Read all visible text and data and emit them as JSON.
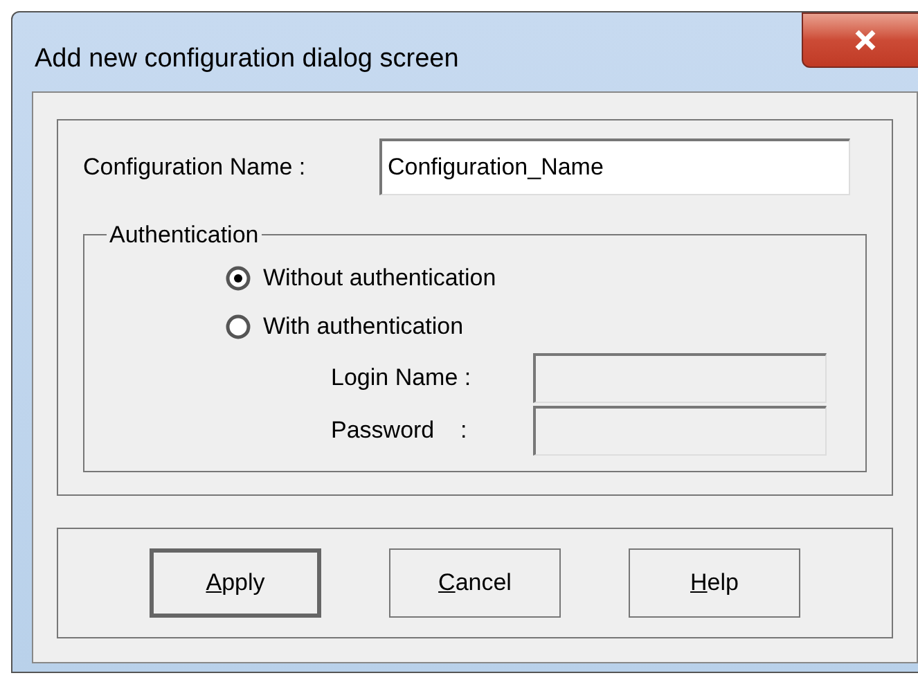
{
  "window": {
    "title": "Add new configuration dialog screen"
  },
  "configuration_name": {
    "label": "Configuration Name :",
    "value": "Configuration_Name"
  },
  "authentication": {
    "legend": "Authentication",
    "options": [
      {
        "label": "Without authentication",
        "selected": true
      },
      {
        "label": "With authentication",
        "selected": false
      }
    ],
    "fields": [
      {
        "label": "Login Name :",
        "disabled": true
      },
      {
        "label": "Password    :",
        "disabled": true
      }
    ]
  },
  "buttons": [
    {
      "label": "Apply",
      "first_letter_underlined": true,
      "default": true
    },
    {
      "label": "Cancel",
      "first_letter_underlined": true,
      "default": false
    },
    {
      "label": "Help",
      "first_letter_underlined": true,
      "default": false
    }
  ]
}
